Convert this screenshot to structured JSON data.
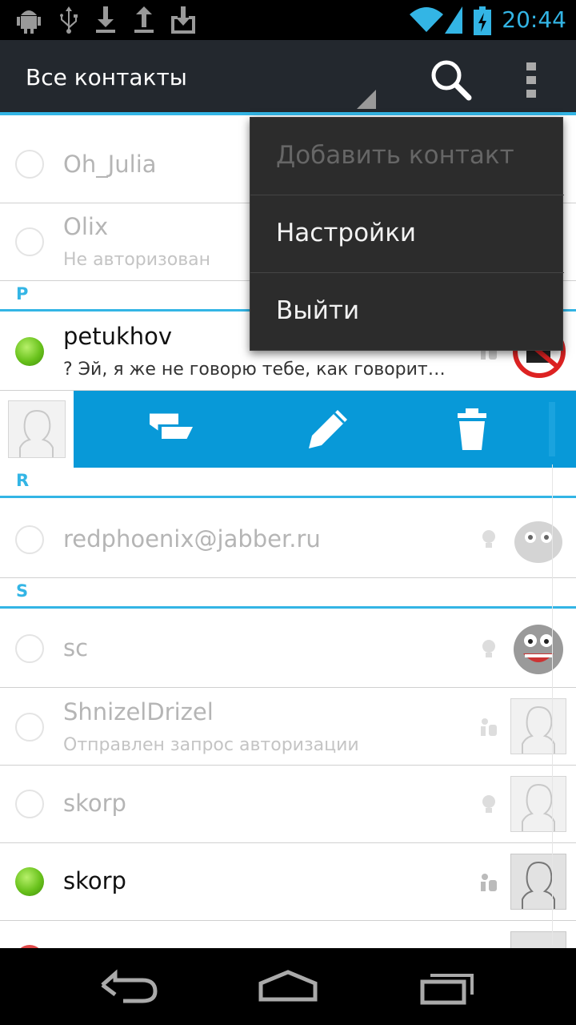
{
  "status_bar": {
    "time": "20:44",
    "icons": [
      "android-debug-icon",
      "usb-icon",
      "download-icon",
      "upload-icon",
      "download-box-icon",
      "wifi-icon",
      "signal-icon",
      "battery-charging-icon"
    ]
  },
  "action_bar": {
    "title": "Все контакты",
    "search_icon": "search-icon",
    "overflow_icon": "overflow-menu-icon"
  },
  "menu": {
    "items": [
      {
        "label": "Добавить контакт",
        "enabled": false
      },
      {
        "label": "Настройки",
        "enabled": true
      },
      {
        "label": "Выйти",
        "enabled": true
      }
    ]
  },
  "contacts": {
    "items": [
      {
        "name": "Oh_Julia",
        "subtitle": "",
        "online": false
      },
      {
        "name": "Olix",
        "subtitle": "Не авторизован",
        "online": false
      },
      {
        "name": "petukhov",
        "subtitle": "? Эй, я же не говорю тебе, как говорит…",
        "online": true
      },
      {
        "name": "redphoenix@jabber.ru",
        "subtitle": "",
        "online": false
      },
      {
        "name": "sc",
        "subtitle": "",
        "online": false
      },
      {
        "name": "ShnizelDrizel",
        "subtitle": "Отправлен запрос авторизации",
        "online": false
      },
      {
        "name": "skorp",
        "subtitle": "",
        "online": false
      },
      {
        "name": "skorp",
        "subtitle": "",
        "online": true
      }
    ]
  },
  "sections": {
    "p": "P",
    "r": "R",
    "s": "S"
  },
  "action_strip": {
    "buttons": [
      "chat-icon",
      "edit-pencil-icon",
      "trash-icon"
    ],
    "color": "#0899d8"
  },
  "colors": {
    "accent": "#33b5e5",
    "action_bar": "#23282e",
    "online": "#69c21c"
  }
}
